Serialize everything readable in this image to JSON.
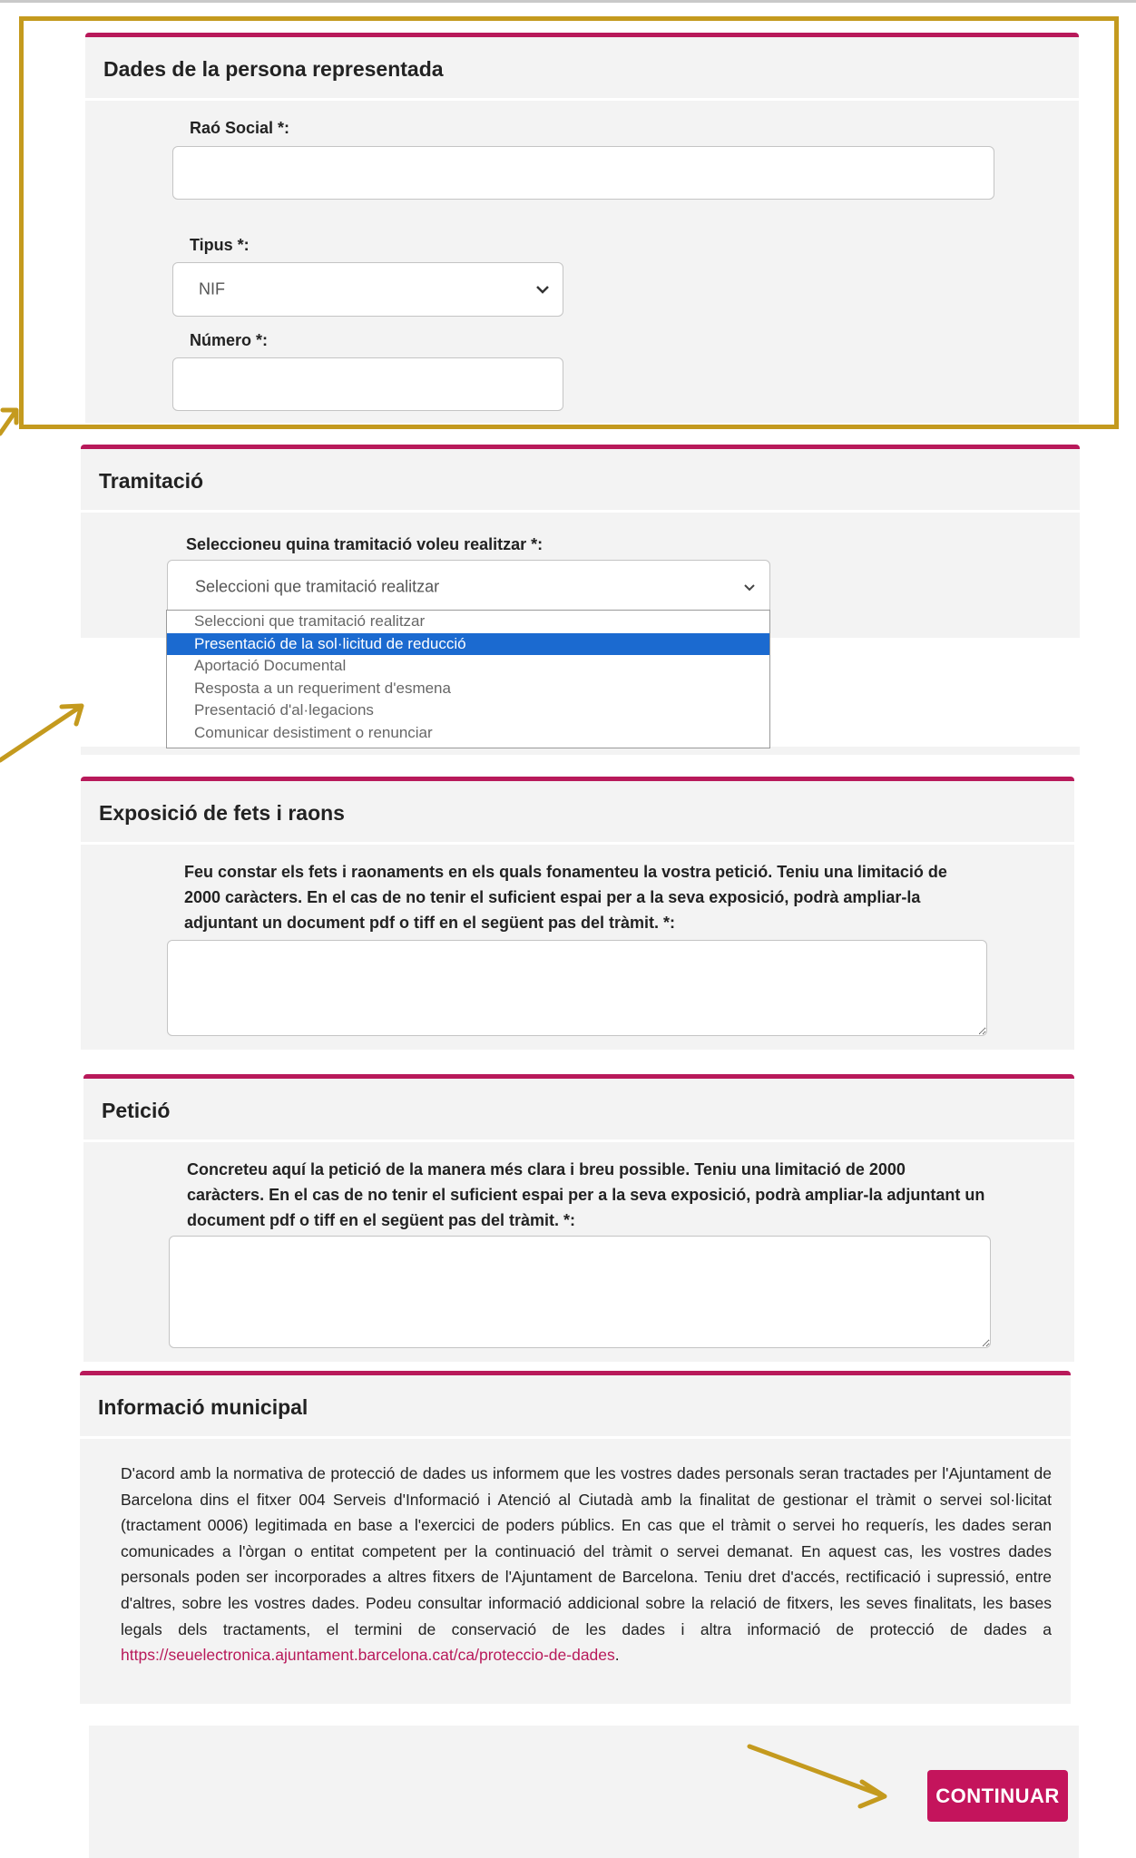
{
  "represented": {
    "title": "Dades de la persona representada",
    "company_label": "Raó Social *:",
    "company_value": "",
    "type_label": "Tipus *:",
    "type_selected": "NIF",
    "number_label": "Número *:",
    "number_value": ""
  },
  "tramitacio": {
    "title": "Tramitació",
    "select_label": "Seleccioneu quina tramitació voleu realitzar *:",
    "select_placeholder": "Seleccioni que tramitació realitzar",
    "options": [
      "Seleccioni que tramitació realitzar",
      "Presentació de la sol·licitud de reducció",
      "Aportació Documental",
      "Resposta a un requeriment d'esmena",
      "Presentació d'al·legacions",
      "Comunicar desistiment o renunciar"
    ],
    "highlighted_option": 1
  },
  "exposicio": {
    "title": "Exposició de fets i raons",
    "instructions": "Feu constar els fets i raonaments en els quals fonamenteu la vostra petició. Teniu una limitació de 2000 caràcters. En el cas de no tenir el suficient espai per a la seva exposició, podrà ampliar-la adjuntant un document pdf o tiff en el següent pas del tràmit. *:",
    "value": ""
  },
  "peticio": {
    "title": "Petició",
    "instructions": "Concreteu aquí la petició de la manera més clara i breu possible. Teniu una limitació de 2000 caràcters. En el cas de no tenir el suficient espai per a la seva exposició, podrà ampliar-la adjuntant un document pdf o tiff en el següent pas del tràmit. *:",
    "value": ""
  },
  "info": {
    "title": "Informació municipal",
    "text": "D'acord amb la normativa de protecció de dades us informem que les vostres dades personals seran tractades per l'Ajuntament de Barcelona dins el fitxer 004 Serveis d'Informació i Atenció al Ciutadà amb la finalitat de gestionar el tràmit o servei sol·licitat (tractament 0006) legitimada en base a l'exercici de poders públics. En cas que el tràmit o servei ho requerís, les dades seran comunicades a l'òrgan o entitat competent per la continuació del tràmit o servei demanat. En aquest cas, les vostres dades personals poden ser incorporades a altres fitxers de l'Ajuntament de Barcelona. Teniu dret d'accés, rectificació i supressió, entre d'altres, sobre les vostres dades. Podeu consultar informació addicional sobre la relació de fitxers, les seves finalitats, les bases legals dels tractaments, el termini de conservació de les dades i altra informació de protecció de dades a ",
    "link": "https://seuelectronica.ajuntament.barcelona.cat/ca/proteccio-de-dades",
    "text_end": "."
  },
  "actions": {
    "continue_label": "CONTINUAR"
  },
  "colors": {
    "accent": "#b8195a",
    "button": "#c4145c",
    "callout": "#c49a1e",
    "selected_option": "#1b6ad0",
    "panel_bg": "#f3f3f3"
  },
  "icons": {
    "select_arrow": "chevron-down-icon"
  }
}
